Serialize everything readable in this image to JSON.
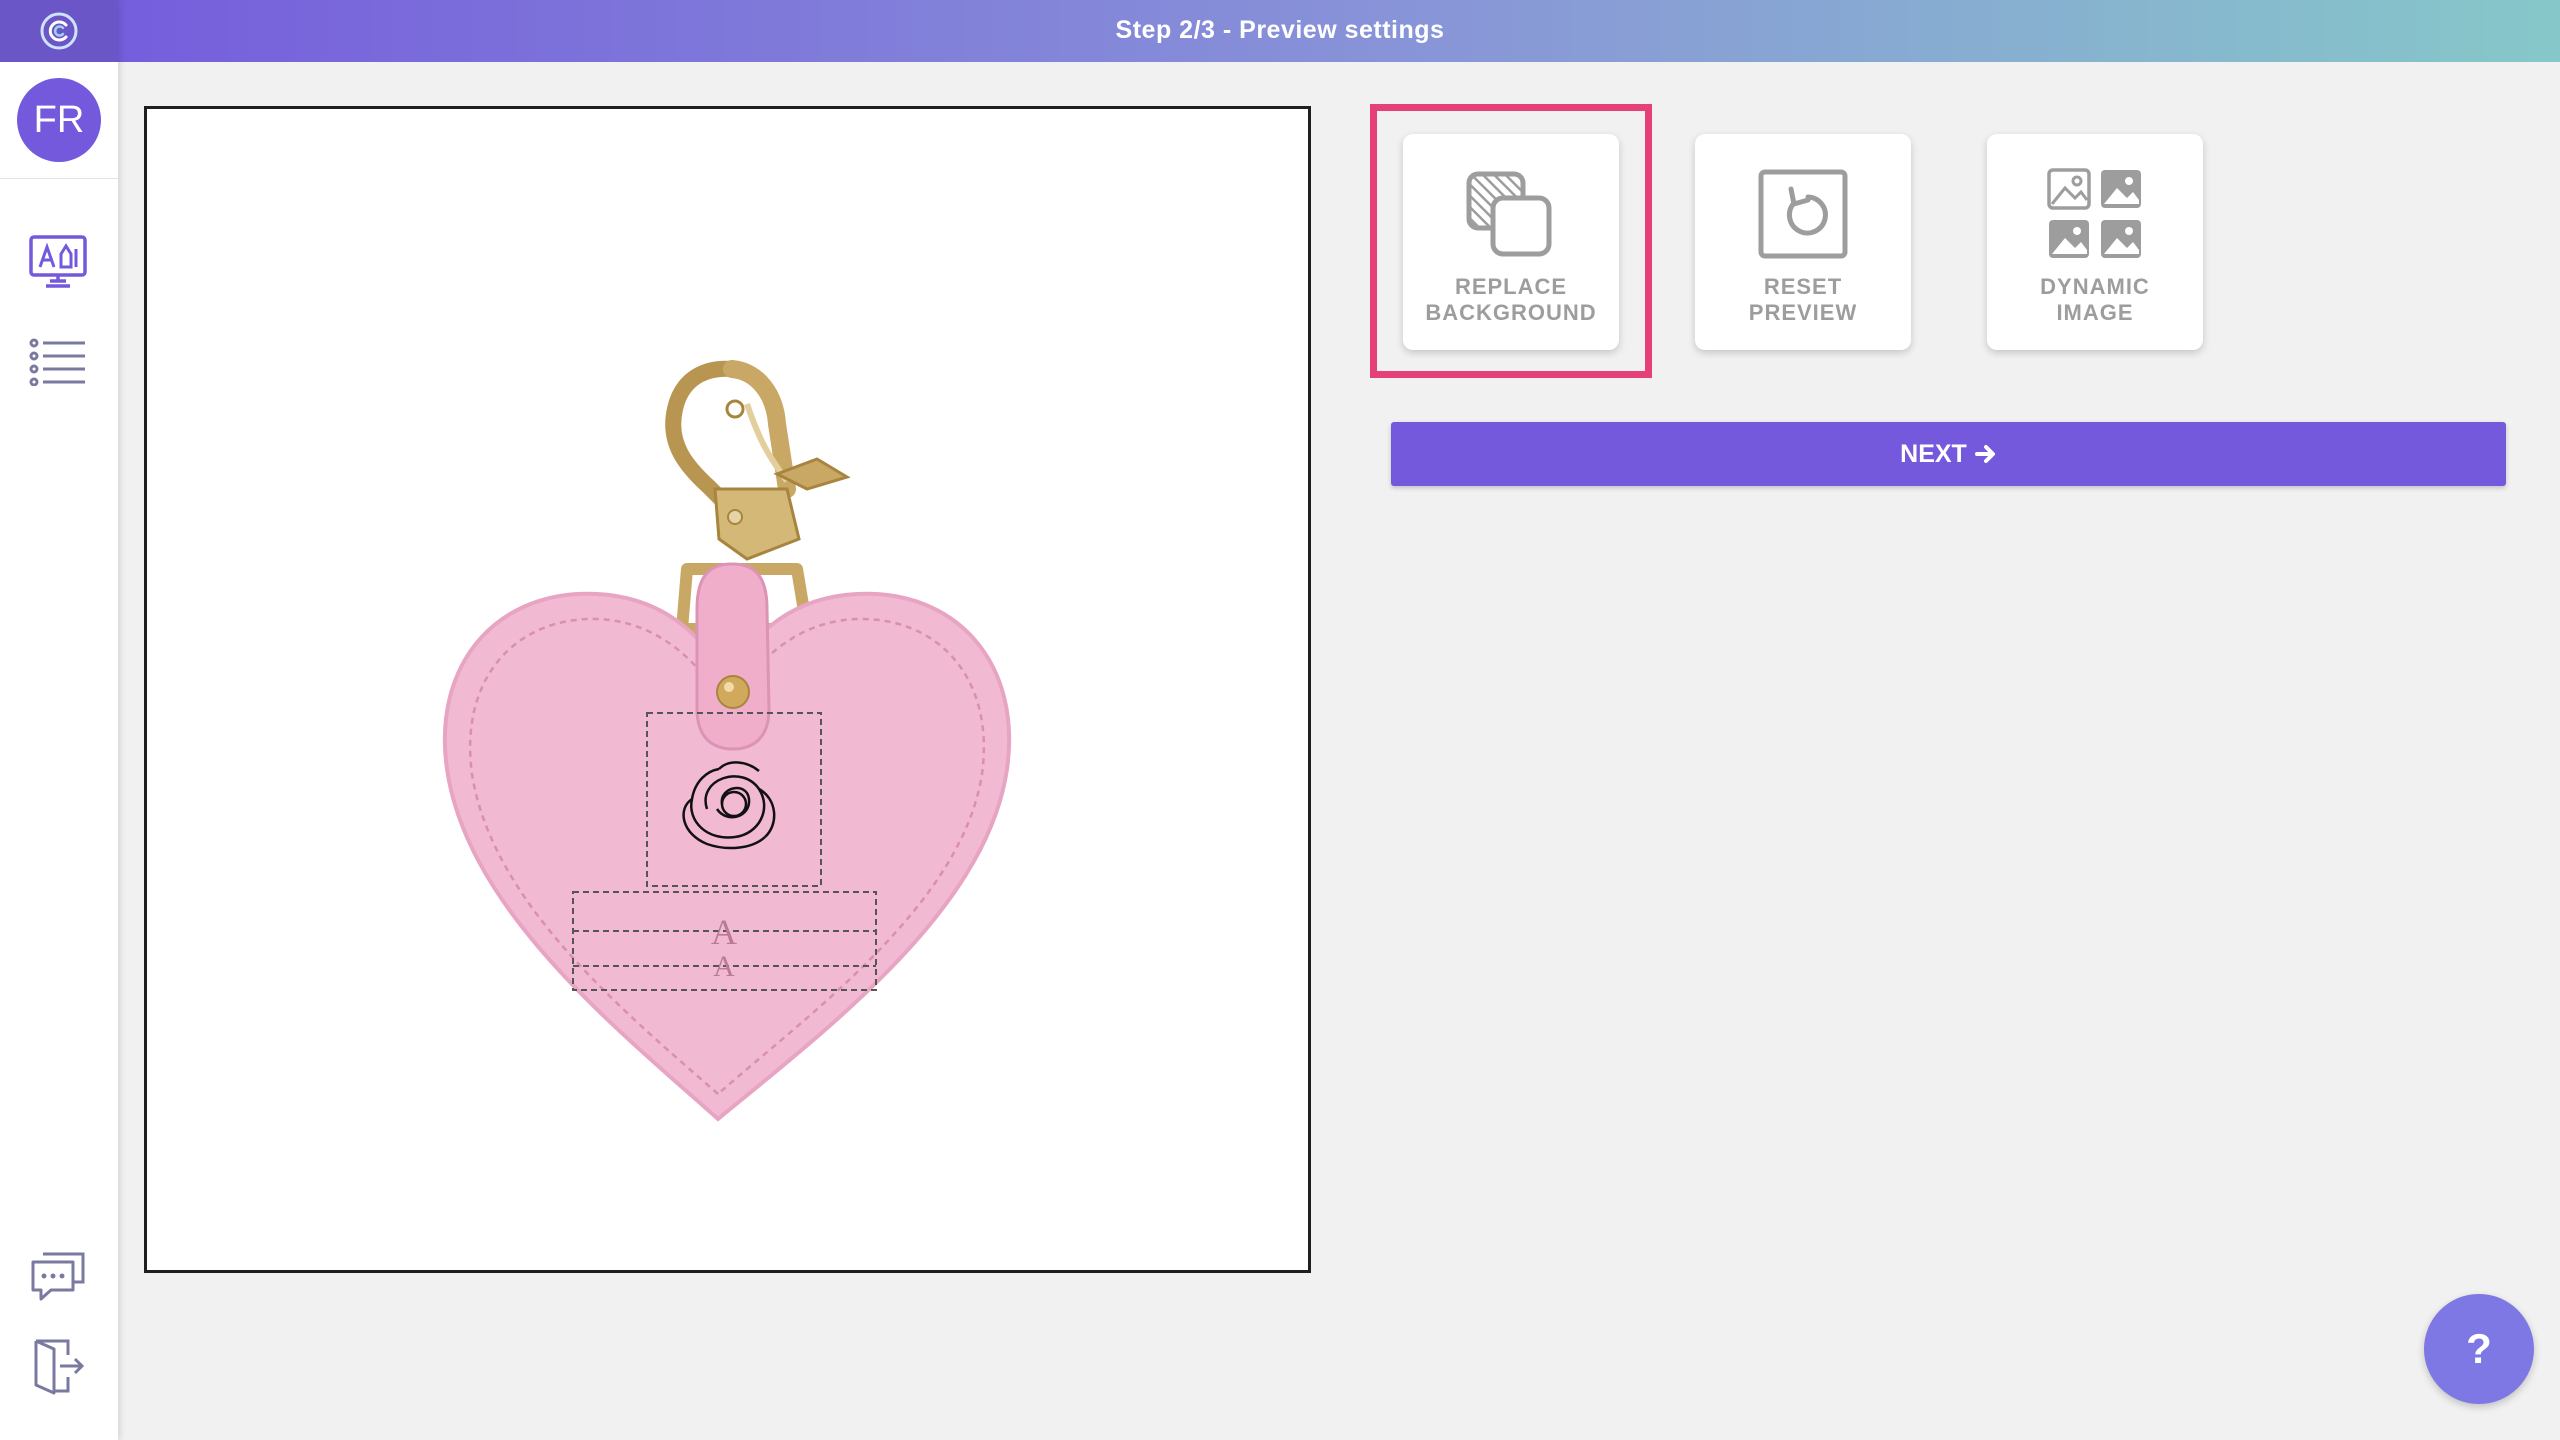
{
  "header": {
    "title": "Step 2/3 - Preview settings"
  },
  "sidebar": {
    "avatar_initials": "FR",
    "items": [
      {
        "name": "design-preview",
        "icon": "monitor-design-icon"
      },
      {
        "name": "list",
        "icon": "list-icon"
      }
    ],
    "bottom_items": [
      {
        "name": "chat",
        "icon": "chat-icon"
      },
      {
        "name": "logout",
        "icon": "logout-door-icon"
      }
    ]
  },
  "canvas": {
    "product": "pink-heart-keychain",
    "engraving_placeholder": "A"
  },
  "actions": [
    {
      "id": "replace-background",
      "label": "REPLACE\nBACKGROUND",
      "icon": "layers-icon",
      "highlighted": true
    },
    {
      "id": "reset-preview",
      "label": "RESET\nPREVIEW",
      "icon": "reset-icon",
      "highlighted": false
    },
    {
      "id": "dynamic-image",
      "label": "DYNAMIC\nIMAGE",
      "icon": "image-grid-icon",
      "highlighted": false
    }
  ],
  "next_button": {
    "label": "NEXT",
    "icon": "arrow-right-icon"
  },
  "help_button": {
    "label": "?"
  },
  "colors": {
    "accent": "#7459dc",
    "highlight": "#e5407a",
    "heart": "#f2b9d2",
    "gold": "#c9a865"
  }
}
